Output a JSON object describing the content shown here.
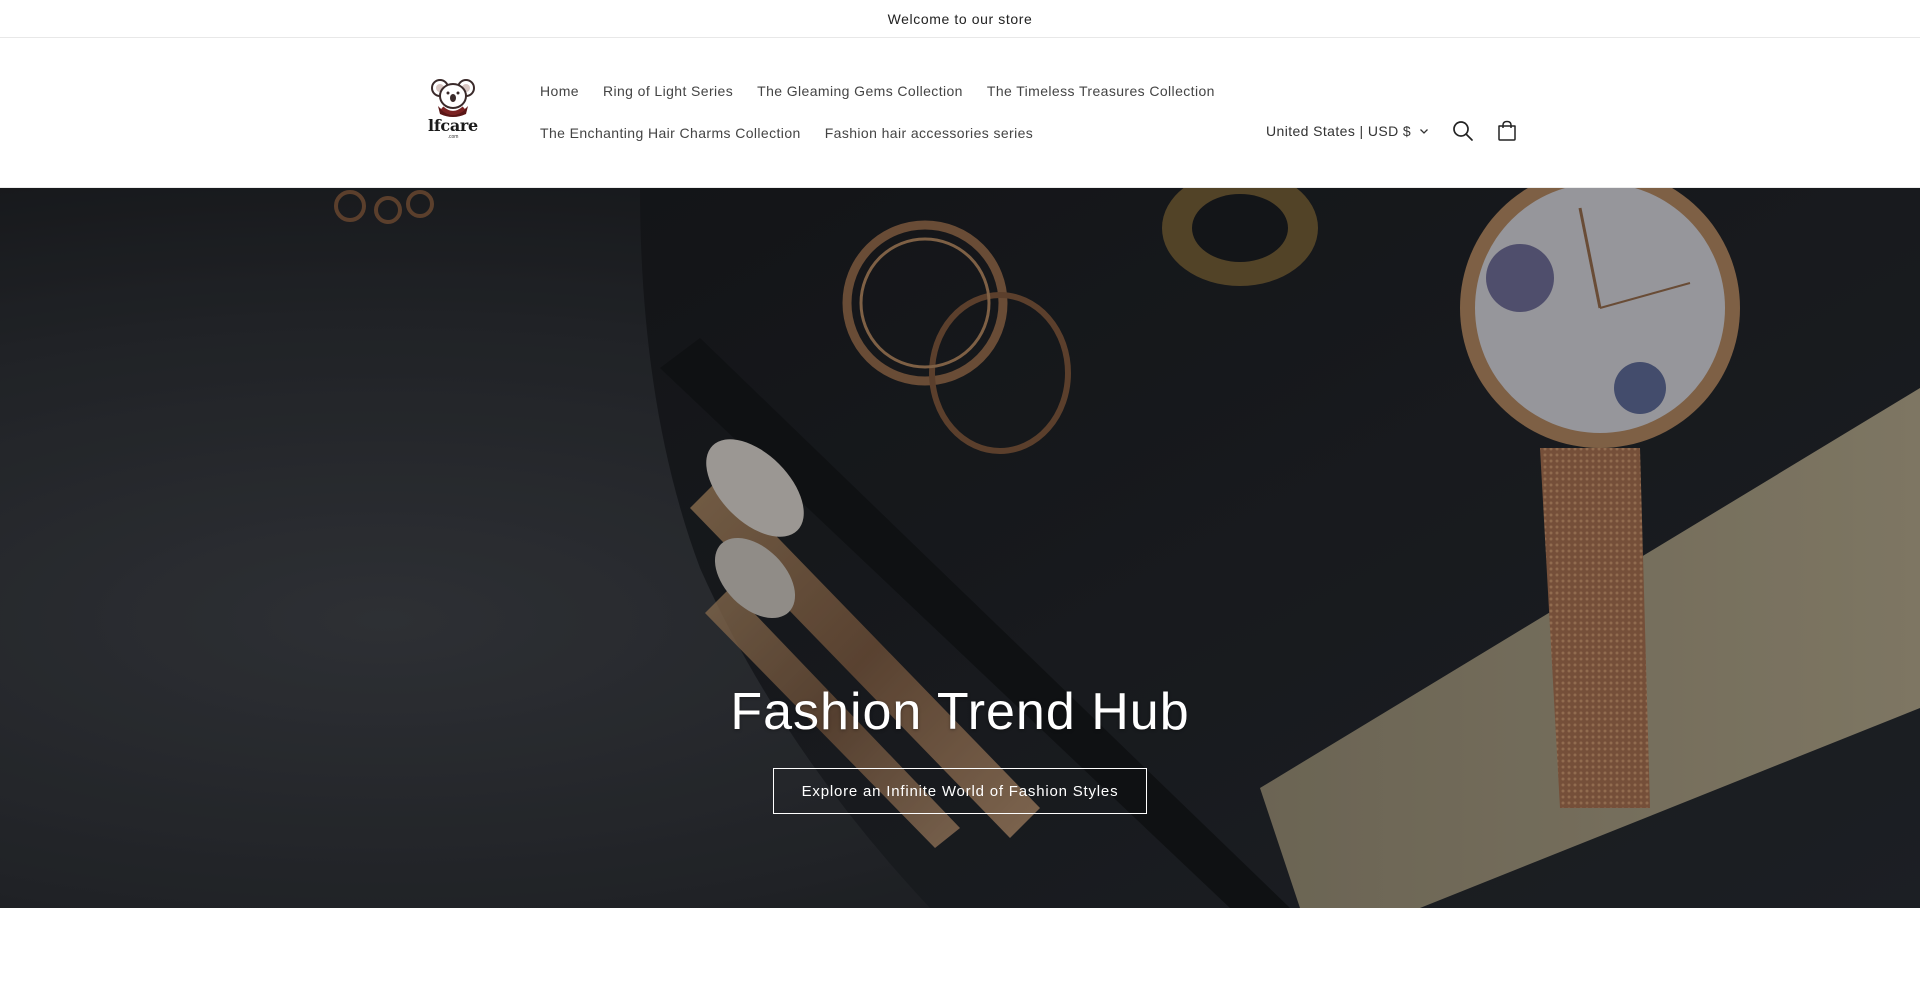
{
  "announcement": {
    "text": "Welcome to our store"
  },
  "header": {
    "logo": {
      "text": "lfcare",
      "sub": ".com"
    },
    "nav": [
      {
        "label": "Home"
      },
      {
        "label": "Ring of Light Series"
      },
      {
        "label": "The Gleaming Gems Collection"
      },
      {
        "label": "The Timeless Treasures Collection"
      },
      {
        "label": "The Enchanting Hair Charms Collection"
      },
      {
        "label": "Fashion hair accessories series"
      }
    ],
    "country_selector": {
      "label": "United States | USD $",
      "icon": "chevron-down-icon"
    },
    "icons": {
      "search": "search-icon",
      "cart": "cart-icon"
    }
  },
  "hero": {
    "title": "Fashion Trend Hub",
    "button_label": "Explore an Infinite World of Fashion Styles",
    "overlay_color": "#000000"
  }
}
